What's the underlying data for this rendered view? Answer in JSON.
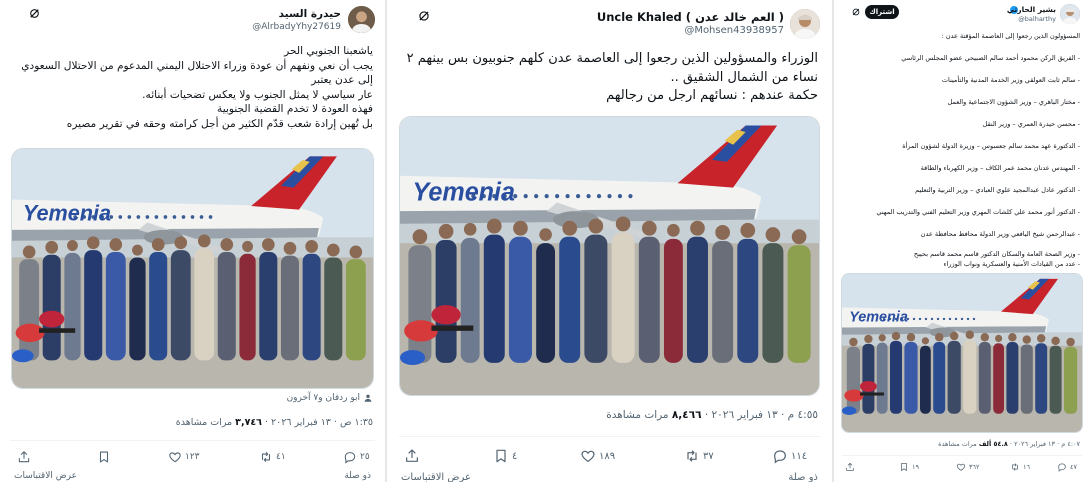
{
  "panel1": {
    "name": "حيدرة السيد",
    "handle": "@AlrbadyYhy27619",
    "lines": [
      "ياشعبنا الجنوبي الحر",
      "يجب أن نعي ونفهم أن عودة وزراء الاحتلال اليمني المدعوم من الاحتلال السعودي",
      "إلى عدن يعتبر",
      "عار سياسي لا يمثل الجنوب ولا يعكس تضحيات أبنائه.",
      "فهذه العودة لا تخدم القضية الجنوبية",
      "بل تُهين إرادة شعب قدّم الكثير من أجل كرامته وحقه في تقرير مصيره"
    ],
    "tagged": "ابو ردفان و٧ آخرون",
    "time": "١:٣٥ ص · ١٣ فبراير ٢٠٢٦ · ",
    "views_count": "٣,٧٤٦",
    "views_label": " مرات مشاهدة",
    "replies": "٢٥",
    "retweets": "٤١",
    "likes": "١٢٣",
    "more_replies": "ذو صلة",
    "show_quotes": "عرض الاقتباسات"
  },
  "panel2": {
    "name": "Uncle Khaled ( العم خالد عدن )",
    "handle": "@Mohsen43938957",
    "lines": [
      "الوزراء والمسؤولين الذين رجعوا إلى العاصمة عدن كلهم جنوبيون بس بينهم ٢",
      "نساء من الشمال الشقيق ..",
      "حكمة عندهم : نسائهم ارجل من رجالهم"
    ],
    "time": "٤:٥٥ م · ١٣ فبراير ٢٠٢٦ · ",
    "views_count": "٨,٤٦٦",
    "views_label": " مرات مشاهدة",
    "replies": "١١٤",
    "retweets": "٣٧",
    "likes": "١٨٩",
    "bookmarks": "٤",
    "more_replies": "ذو صلة",
    "show_quotes": "عرض الاقتباسات"
  },
  "panel3": {
    "name": "بشير الحارثي",
    "handle": "@balharthy",
    "subscribe": "اشتراك",
    "lines": [
      "المسؤولون الذين رجعوا إلى العاصمة المؤقتة عدن :",
      "- الفريق الركن محمود أحمد سالم الصبيحي عضو المجلس الرئاسي",
      "- سالم ثابت العولقي وزير الخدمة المدنية والتأمينات",
      "- مختار الباهري – وزير الشؤون الاجتماعية والعمل",
      "- محسن حيدرة العمري – وزير النقل",
      "- الدكتورة عهد محمد سالم جعسوس – وزيرة الدولة لشؤون المرأة",
      "- المهندس عدنان محمد عمر الكاف – وزير الكهرباء والطاقة",
      "- الدكتور عادل عبدالمجيد علوي العبادي – وزير التربية والتعليم",
      "- الدكتور أنور محمد علي كلشات المهري وزير التعليم الفني والتدريب المهني",
      "- عبدالرحمن شيخ اليافعي وزير الدولة محافظ محافظة عدن",
      "- وزير الصحة العامة والسكان الدكتور قاسم محمد قاسم بحيبح",
      "- عدد من القيادات الأمنية والعسكرية ونواب الوزراء"
    ],
    "time": "٤:٠٧ م · ١٣ فبراير ٢٠٢٦ · ",
    "views_count": "٥٤.٨ ألف",
    "views_label": " مرات مشاهدة",
    "replies": "٤٧",
    "retweets": "١٦",
    "likes": "٣٦٢",
    "bookmarks": "١٩"
  },
  "photo": {
    "airline_logo": "Yemenia"
  },
  "icons": {
    "grok": "grok-icon",
    "reply": "reply-icon",
    "retweet": "retweet-icon",
    "like": "heart-icon",
    "bookmark": "bookmark-icon",
    "share": "share-icon",
    "person": "person-icon"
  },
  "colors": {
    "text": "#0f1419",
    "secondary": "#536471",
    "verified": "#1d9bf0",
    "sky": "#d6e2ec",
    "tarmac": "#b9b6ad",
    "plane_red": "#c8232a",
    "plane_blue": "#2a4fa0"
  }
}
